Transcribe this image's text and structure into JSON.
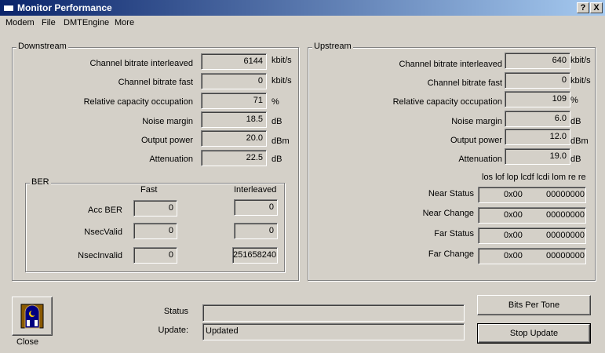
{
  "window": {
    "title": "Monitor Performance",
    "help_label": "?",
    "close_label": "X"
  },
  "menu": [
    "Modem",
    "File",
    "DMTEngine",
    "More"
  ],
  "downstream": {
    "title": "Downstream",
    "rows": [
      {
        "label": "Channel bitrate interleaved",
        "value": "6144",
        "unit": "kbit/s"
      },
      {
        "label": "Channel bitrate fast",
        "value": "0",
        "unit": "kbit/s"
      },
      {
        "label": "Relative capacity occupation",
        "value": "71",
        "unit": "%"
      },
      {
        "label": "Noise margin",
        "value": "18.5",
        "unit": "dB"
      },
      {
        "label": "Output power",
        "value": "20.0",
        "unit": "dBm"
      },
      {
        "label": "Attenuation",
        "value": "22.5",
        "unit": "dB"
      }
    ]
  },
  "ber": {
    "title": "BER",
    "col_fast": "Fast",
    "col_interleaved": "Interleaved",
    "rows": [
      {
        "label": "Acc BER",
        "fast": "0",
        "interleaved": "0"
      },
      {
        "label": "NsecValid",
        "fast": "0",
        "interleaved": "0"
      },
      {
        "label": "NsecInvalid",
        "fast": "0",
        "interleaved": "251658240"
      }
    ]
  },
  "upstream": {
    "title": "Upstream",
    "rows": [
      {
        "label": "Channel bitrate interleaved",
        "value": "640",
        "unit": "kbit/s"
      },
      {
        "label": "Channel bitrate fast",
        "value": "0",
        "unit": "kbit/s"
      },
      {
        "label": "Relative capacity occupation",
        "value": "109",
        "unit": "%"
      },
      {
        "label": "Noise margin",
        "value": "6.0",
        "unit": "dB"
      },
      {
        "label": "Output power",
        "value": "12.0",
        "unit": "dBm"
      },
      {
        "label": "Attenuation",
        "value": "19.0",
        "unit": "dB"
      }
    ],
    "flags_header": "los lof lop lcdf lcdi lom re re",
    "status_rows": [
      {
        "label": "Near Status",
        "hex": "0x00",
        "bits": "00000000"
      },
      {
        "label": "Near Change",
        "hex": "0x00",
        "bits": "00000000"
      },
      {
        "label": "Far Status",
        "hex": "0x00",
        "bits": "00000000"
      },
      {
        "label": "Far Change",
        "hex": "0x00",
        "bits": "00000000"
      }
    ]
  },
  "bottom": {
    "close_label": "Close",
    "status_label": "Status",
    "status_value": "",
    "update_label": "Update:",
    "update_value": "Updated",
    "bits_per_tone": "Bits Per Tone",
    "stop_update": "Stop Update"
  }
}
